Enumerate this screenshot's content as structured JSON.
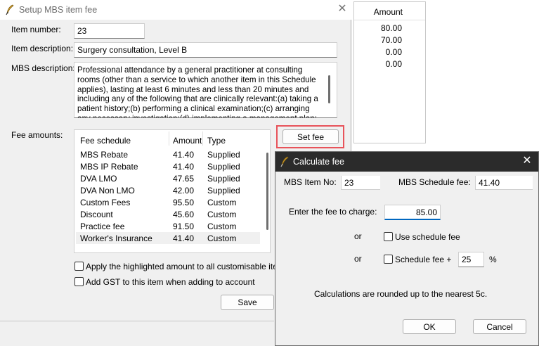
{
  "background_panel": {
    "header": "Amount",
    "values": [
      "80.00",
      "70.00",
      "0.00",
      "0.00"
    ]
  },
  "main": {
    "title": "Setup MBS item fee",
    "labels": {
      "item_number": "Item number:",
      "item_description": "Item description:",
      "mbs_description": "MBS description:",
      "fee_amounts": "Fee amounts:"
    },
    "item_number": "23",
    "item_description": "Surgery consultation, Level B",
    "mbs_description": "Professional attendance by a general practitioner at consulting rooms (other than a service to which another item in this Schedule applies), lasting at least 6 minutes and less than 20 minutes and including any of the following that are clinically relevant:(a) taking a patient history;(b) performing a clinical examination;(c) arranging any necessary investigation;(d) implementing a management plan;(e) providing appropriate",
    "fee_table": {
      "headers": [
        "Fee schedule",
        "Amount",
        "Type"
      ],
      "rows": [
        {
          "schedule": "MBS Rebate",
          "amount": "41.40",
          "type": "Supplied"
        },
        {
          "schedule": "MBS IP Rebate",
          "amount": "41.40",
          "type": "Supplied"
        },
        {
          "schedule": "DVA LMO",
          "amount": "47.65",
          "type": "Supplied"
        },
        {
          "schedule": "DVA Non LMO",
          "amount": "42.00",
          "type": "Supplied"
        },
        {
          "schedule": "Custom Fees",
          "amount": "95.50",
          "type": "Custom"
        },
        {
          "schedule": "Discount",
          "amount": "45.60",
          "type": "Custom"
        },
        {
          "schedule": "Practice fee",
          "amount": "91.50",
          "type": "Custom"
        },
        {
          "schedule": "Worker's Insurance",
          "amount": "41.40",
          "type": "Custom"
        }
      ]
    },
    "set_fee_label": "Set fee",
    "apply_highlighted_label": "Apply the highlighted amount to all customisable items in li",
    "add_gst_label": "Add GST to this item when adding to account",
    "save_label": "Save"
  },
  "calc": {
    "title": "Calculate fee",
    "mbs_item_no_label": "MBS Item No:",
    "mbs_item_no": "23",
    "mbs_schedule_fee_label": "MBS Schedule fee:",
    "mbs_schedule_fee": "41.40",
    "enter_fee_label": "Enter the fee to charge:",
    "fee_value": "85.00",
    "or_label_1": "or",
    "use_schedule_fee_label": "Use schedule fee",
    "or_label_2": "or",
    "schedule_fee_plus_label": "Schedule fee +",
    "percent_value": "25",
    "percent_sign": "%",
    "rounding_note": "Calculations are rounded up to the nearest 5c.",
    "ok_label": "OK",
    "cancel_label": "Cancel"
  }
}
